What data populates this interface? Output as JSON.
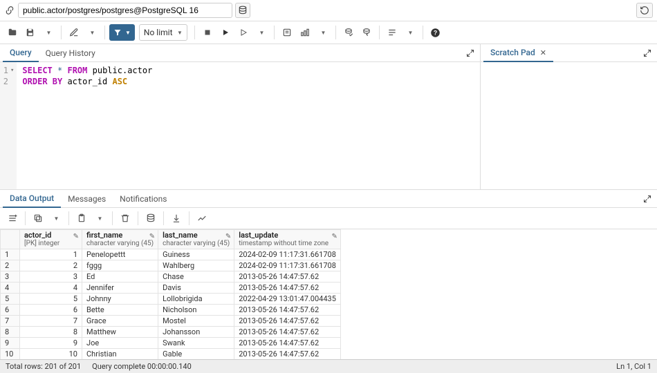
{
  "top": {
    "connection": "public.actor/postgres/postgres@PostgreSQL 16"
  },
  "toolbar": {
    "limit_label": "No limit"
  },
  "editor": {
    "tabs": {
      "query": "Query",
      "history": "Query History"
    },
    "code_line1_select": "SELECT",
    "code_line1_star": "*",
    "code_line1_from": "FROM",
    "code_line1_ident": "public.actor",
    "code_line2_order": "ORDER BY",
    "code_line2_ident": "actor_id",
    "code_line2_asc": "ASC"
  },
  "scratch": {
    "tab": "Scratch Pad"
  },
  "results": {
    "tabs": {
      "data": "Data Output",
      "messages": "Messages",
      "notifications": "Notifications"
    },
    "columns": [
      {
        "name": "actor_id",
        "type": "[PK] integer"
      },
      {
        "name": "first_name",
        "type": "character varying (45)"
      },
      {
        "name": "last_name",
        "type": "character varying (45)"
      },
      {
        "name": "last_update",
        "type": "timestamp without time zone"
      }
    ],
    "rows": [
      {
        "n": "1",
        "id": "1",
        "fn": "Penelopettt",
        "ln": "Guiness",
        "ts": "2024-02-09 11:17:31.661708"
      },
      {
        "n": "2",
        "id": "2",
        "fn": "fggg",
        "ln": "Wahlberg",
        "ts": "2024-02-09 11:17:31.661708"
      },
      {
        "n": "3",
        "id": "3",
        "fn": "Ed",
        "ln": "Chase",
        "ts": "2013-05-26 14:47:57.62"
      },
      {
        "n": "4",
        "id": "4",
        "fn": "Jennifer",
        "ln": "Davis",
        "ts": "2013-05-26 14:47:57.62"
      },
      {
        "n": "5",
        "id": "5",
        "fn": "Johnny",
        "ln": "Lollobrigida",
        "ts": "2022-04-29 13:01:47.004435"
      },
      {
        "n": "6",
        "id": "6",
        "fn": "Bette",
        "ln": "Nicholson",
        "ts": "2013-05-26 14:47:57.62"
      },
      {
        "n": "7",
        "id": "7",
        "fn": "Grace",
        "ln": "Mostel",
        "ts": "2013-05-26 14:47:57.62"
      },
      {
        "n": "8",
        "id": "8",
        "fn": "Matthew",
        "ln": "Johansson",
        "ts": "2013-05-26 14:47:57.62"
      },
      {
        "n": "9",
        "id": "9",
        "fn": "Joe",
        "ln": "Swank",
        "ts": "2013-05-26 14:47:57.62"
      },
      {
        "n": "10",
        "id": "10",
        "fn": "Christian",
        "ln": "Gable",
        "ts": "2013-05-26 14:47:57.62"
      }
    ]
  },
  "status": {
    "total": "Total rows: 201 of 201",
    "timing": "Query complete 00:00:00.140",
    "cursor": "Ln 1, Col 1"
  }
}
